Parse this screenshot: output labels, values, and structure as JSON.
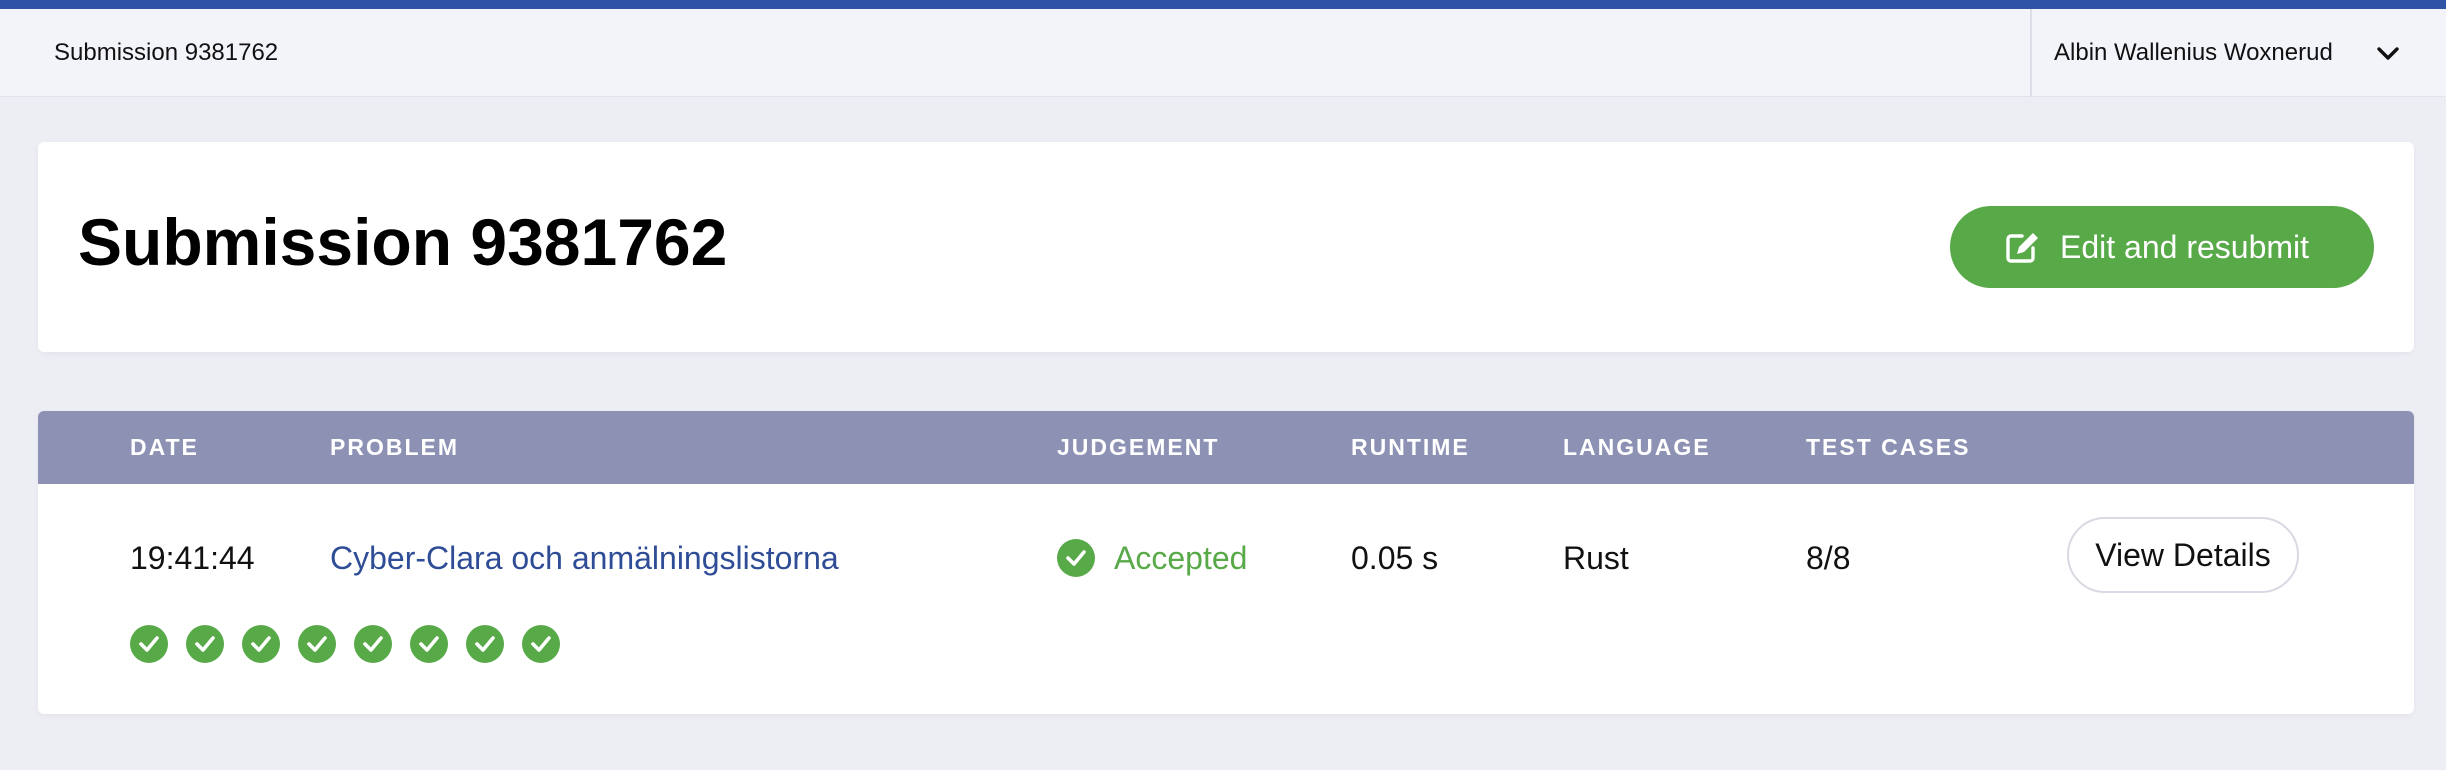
{
  "topbar": {
    "breadcrumb": "Submission 9381762",
    "user_name": "Albin Wallenius Woxnerud"
  },
  "header": {
    "title": "Submission 9381762",
    "resubmit_label": "Edit and resubmit"
  },
  "table": {
    "columns": {
      "date": "DATE",
      "problem": "PROBLEM",
      "judgement": "JUDGEMENT",
      "runtime": "RUNTIME",
      "language": "LANGUAGE",
      "test_cases": "TEST CASES"
    },
    "row": {
      "date": "19:41:44",
      "problem": "Cyber-Clara och anmälningslistorna",
      "judgement": "Accepted",
      "runtime": "0.05 s",
      "language": "Rust",
      "test_cases": "8/8",
      "details_label": "View Details"
    },
    "test_case_results": [
      "passed",
      "passed",
      "passed",
      "passed",
      "passed",
      "passed",
      "passed",
      "passed"
    ]
  },
  "colors": {
    "accent_bar": "#2f54a6",
    "success": "#58a948",
    "table_header": "#8d92b5",
    "link": "#2f4d96"
  },
  "icons": {
    "user_menu": "chevron-down-icon",
    "resubmit": "edit-icon",
    "status": "check-circle-icon"
  }
}
